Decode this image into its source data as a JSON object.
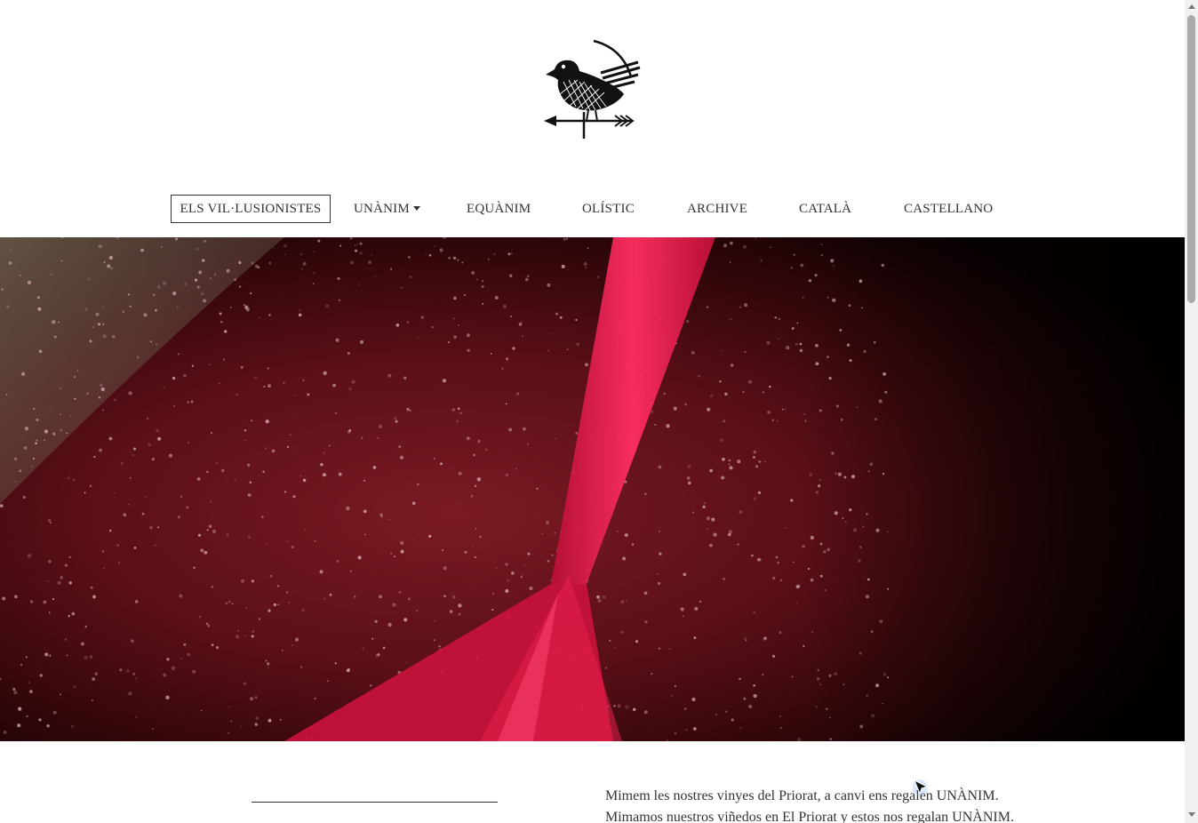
{
  "header": {
    "logo_icon": "bird-weathervane-logo"
  },
  "nav": {
    "items": [
      {
        "label": "ELS VIL·LUSIONISTES",
        "active": true
      },
      {
        "label": "UNÀNIM",
        "dropdown": true
      },
      {
        "label": "EQUÀNIM"
      },
      {
        "label": "OLÍSTIC"
      },
      {
        "label": "ARCHIVE"
      },
      {
        "label": "CATALÀ"
      },
      {
        "label": "CASTELLANO"
      }
    ]
  },
  "hero": {
    "image": "red-grape-must-fermentation-vat",
    "accent": "#d4163f"
  },
  "content": {
    "line_ca": "Mimem les nostres vinyes del Priorat, a canvi ens regalen UNÀNIM.",
    "line_es": "Mimamos nuestros viñedos en El Priorat y estos nos regalan UNÀNIM."
  }
}
